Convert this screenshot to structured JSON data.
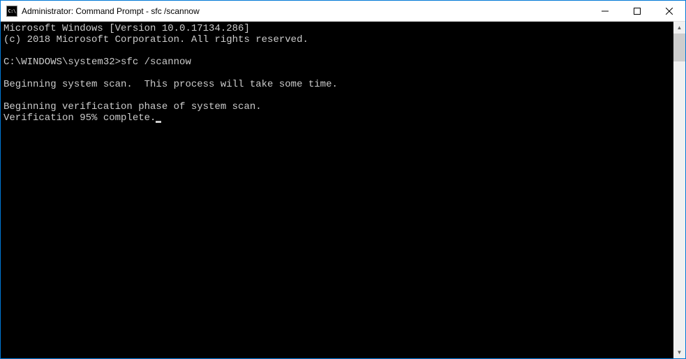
{
  "window": {
    "title": "Administrator: Command Prompt - sfc  /scannow",
    "icon_label": "C:\\"
  },
  "terminal": {
    "lines": [
      "Microsoft Windows [Version 10.0.17134.286]",
      "(c) 2018 Microsoft Corporation. All rights reserved.",
      "",
      "C:\\WINDOWS\\system32>sfc /scannow",
      "",
      "Beginning system scan.  This process will take some time.",
      "",
      "Beginning verification phase of system scan.",
      "Verification 95% complete."
    ]
  }
}
